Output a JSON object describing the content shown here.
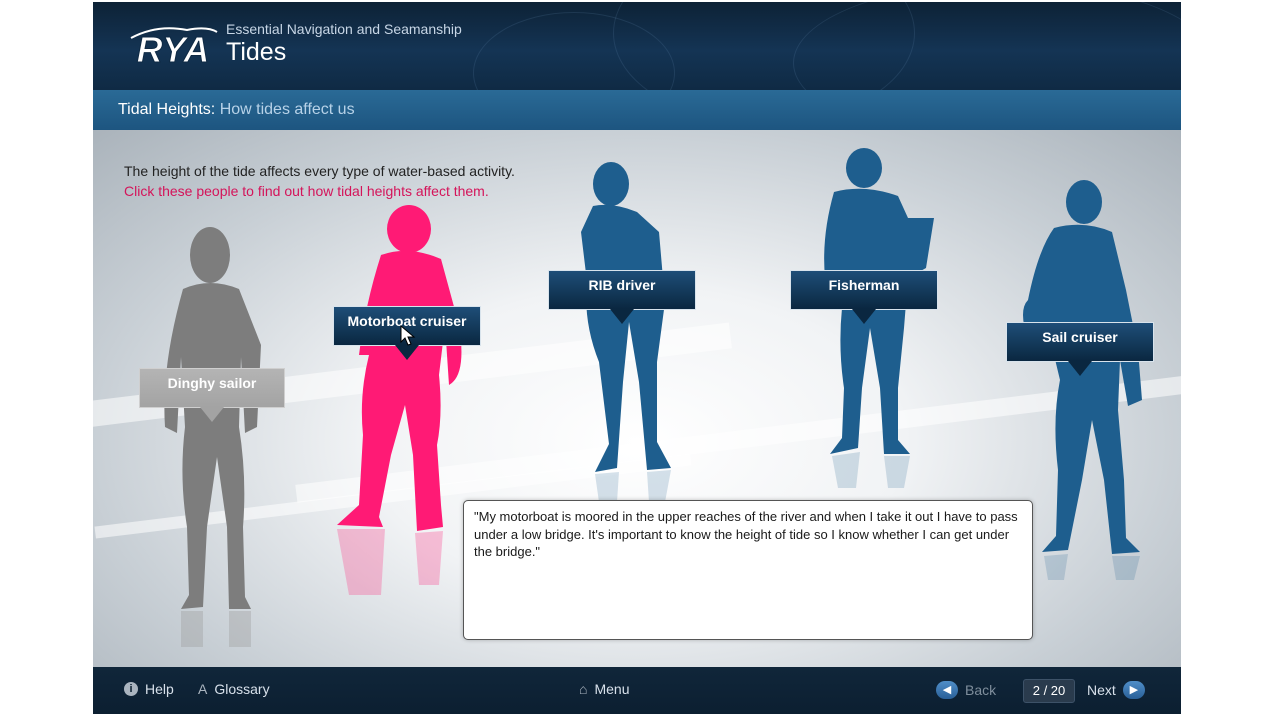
{
  "header": {
    "logo_text": "RYA",
    "course_title": "Essential Navigation and Seamanship",
    "module_title": "Tides"
  },
  "title_bar": {
    "section": "Tidal Heights:",
    "subtitle": "How tides affect us"
  },
  "intro": {
    "line1": "The height of the tide affects every type of water-based activity.",
    "line2": "Click these people to find out how tidal heights affect them."
  },
  "people": [
    {
      "label": "Dinghy sailor",
      "state": "visited",
      "color": "#7d7d7d"
    },
    {
      "label": "Motorboat cruiser",
      "state": "selected",
      "color": "#ff1a75"
    },
    {
      "label": "RIB driver",
      "state": "unvisited",
      "color": "#1e5e8e"
    },
    {
      "label": "Fisherman",
      "state": "unvisited",
      "color": "#1e5e8e"
    },
    {
      "label": "Sail cruiser",
      "state": "unvisited",
      "color": "#1e5e8e"
    }
  ],
  "quote": {
    "text": "\"My motorboat is moored in the upper reaches of the river and when I take it out I have to pass under a low bridge. It's important to know the height of tide so I know whether I can get under the bridge.\""
  },
  "footer": {
    "help": "Help",
    "glossary": "Glossary",
    "menu": "Menu",
    "back": "Back",
    "page_counter": "2 / 20",
    "next": "Next"
  },
  "colors": {
    "header_bg": "#0f2a44",
    "title_bar": "#1d5580",
    "accent_pink": "#d4145a",
    "person_blue": "#1e5e8e",
    "person_grey": "#7d7d7d"
  }
}
